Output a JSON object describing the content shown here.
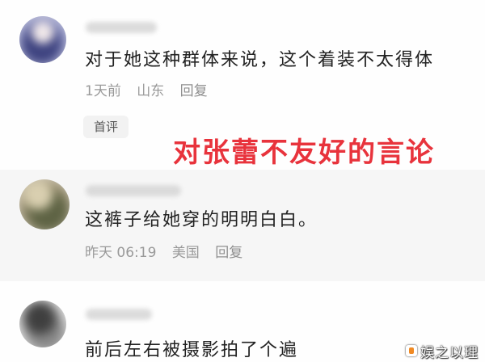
{
  "comments": [
    {
      "avatar_icon": "blurred-avatar",
      "text": "对于她这种群体来说，这个着装不太得体",
      "time": "1天前",
      "location": "山东",
      "reply_label": "回复",
      "badge": "首评"
    },
    {
      "avatar_icon": "blurred-avatar",
      "text": "这裤子给她穿的明明白白。",
      "time": "昨天 06:19",
      "location": "美国",
      "reply_label": "回复"
    },
    {
      "avatar_icon": "blurred-avatar",
      "text": "前后左右被摄影拍了个遍"
    }
  ],
  "annotation": {
    "text": "对张蕾不友好的言论"
  },
  "watermark": {
    "icon": "watermark-logo-icon",
    "text": "娱之以理"
  },
  "colors": {
    "annotation_red": "#e8333c",
    "comment_text": "#222222",
    "meta_text": "#999999",
    "badge_bg": "#f2f2f2",
    "highlight_band": "#f6f6f6"
  }
}
